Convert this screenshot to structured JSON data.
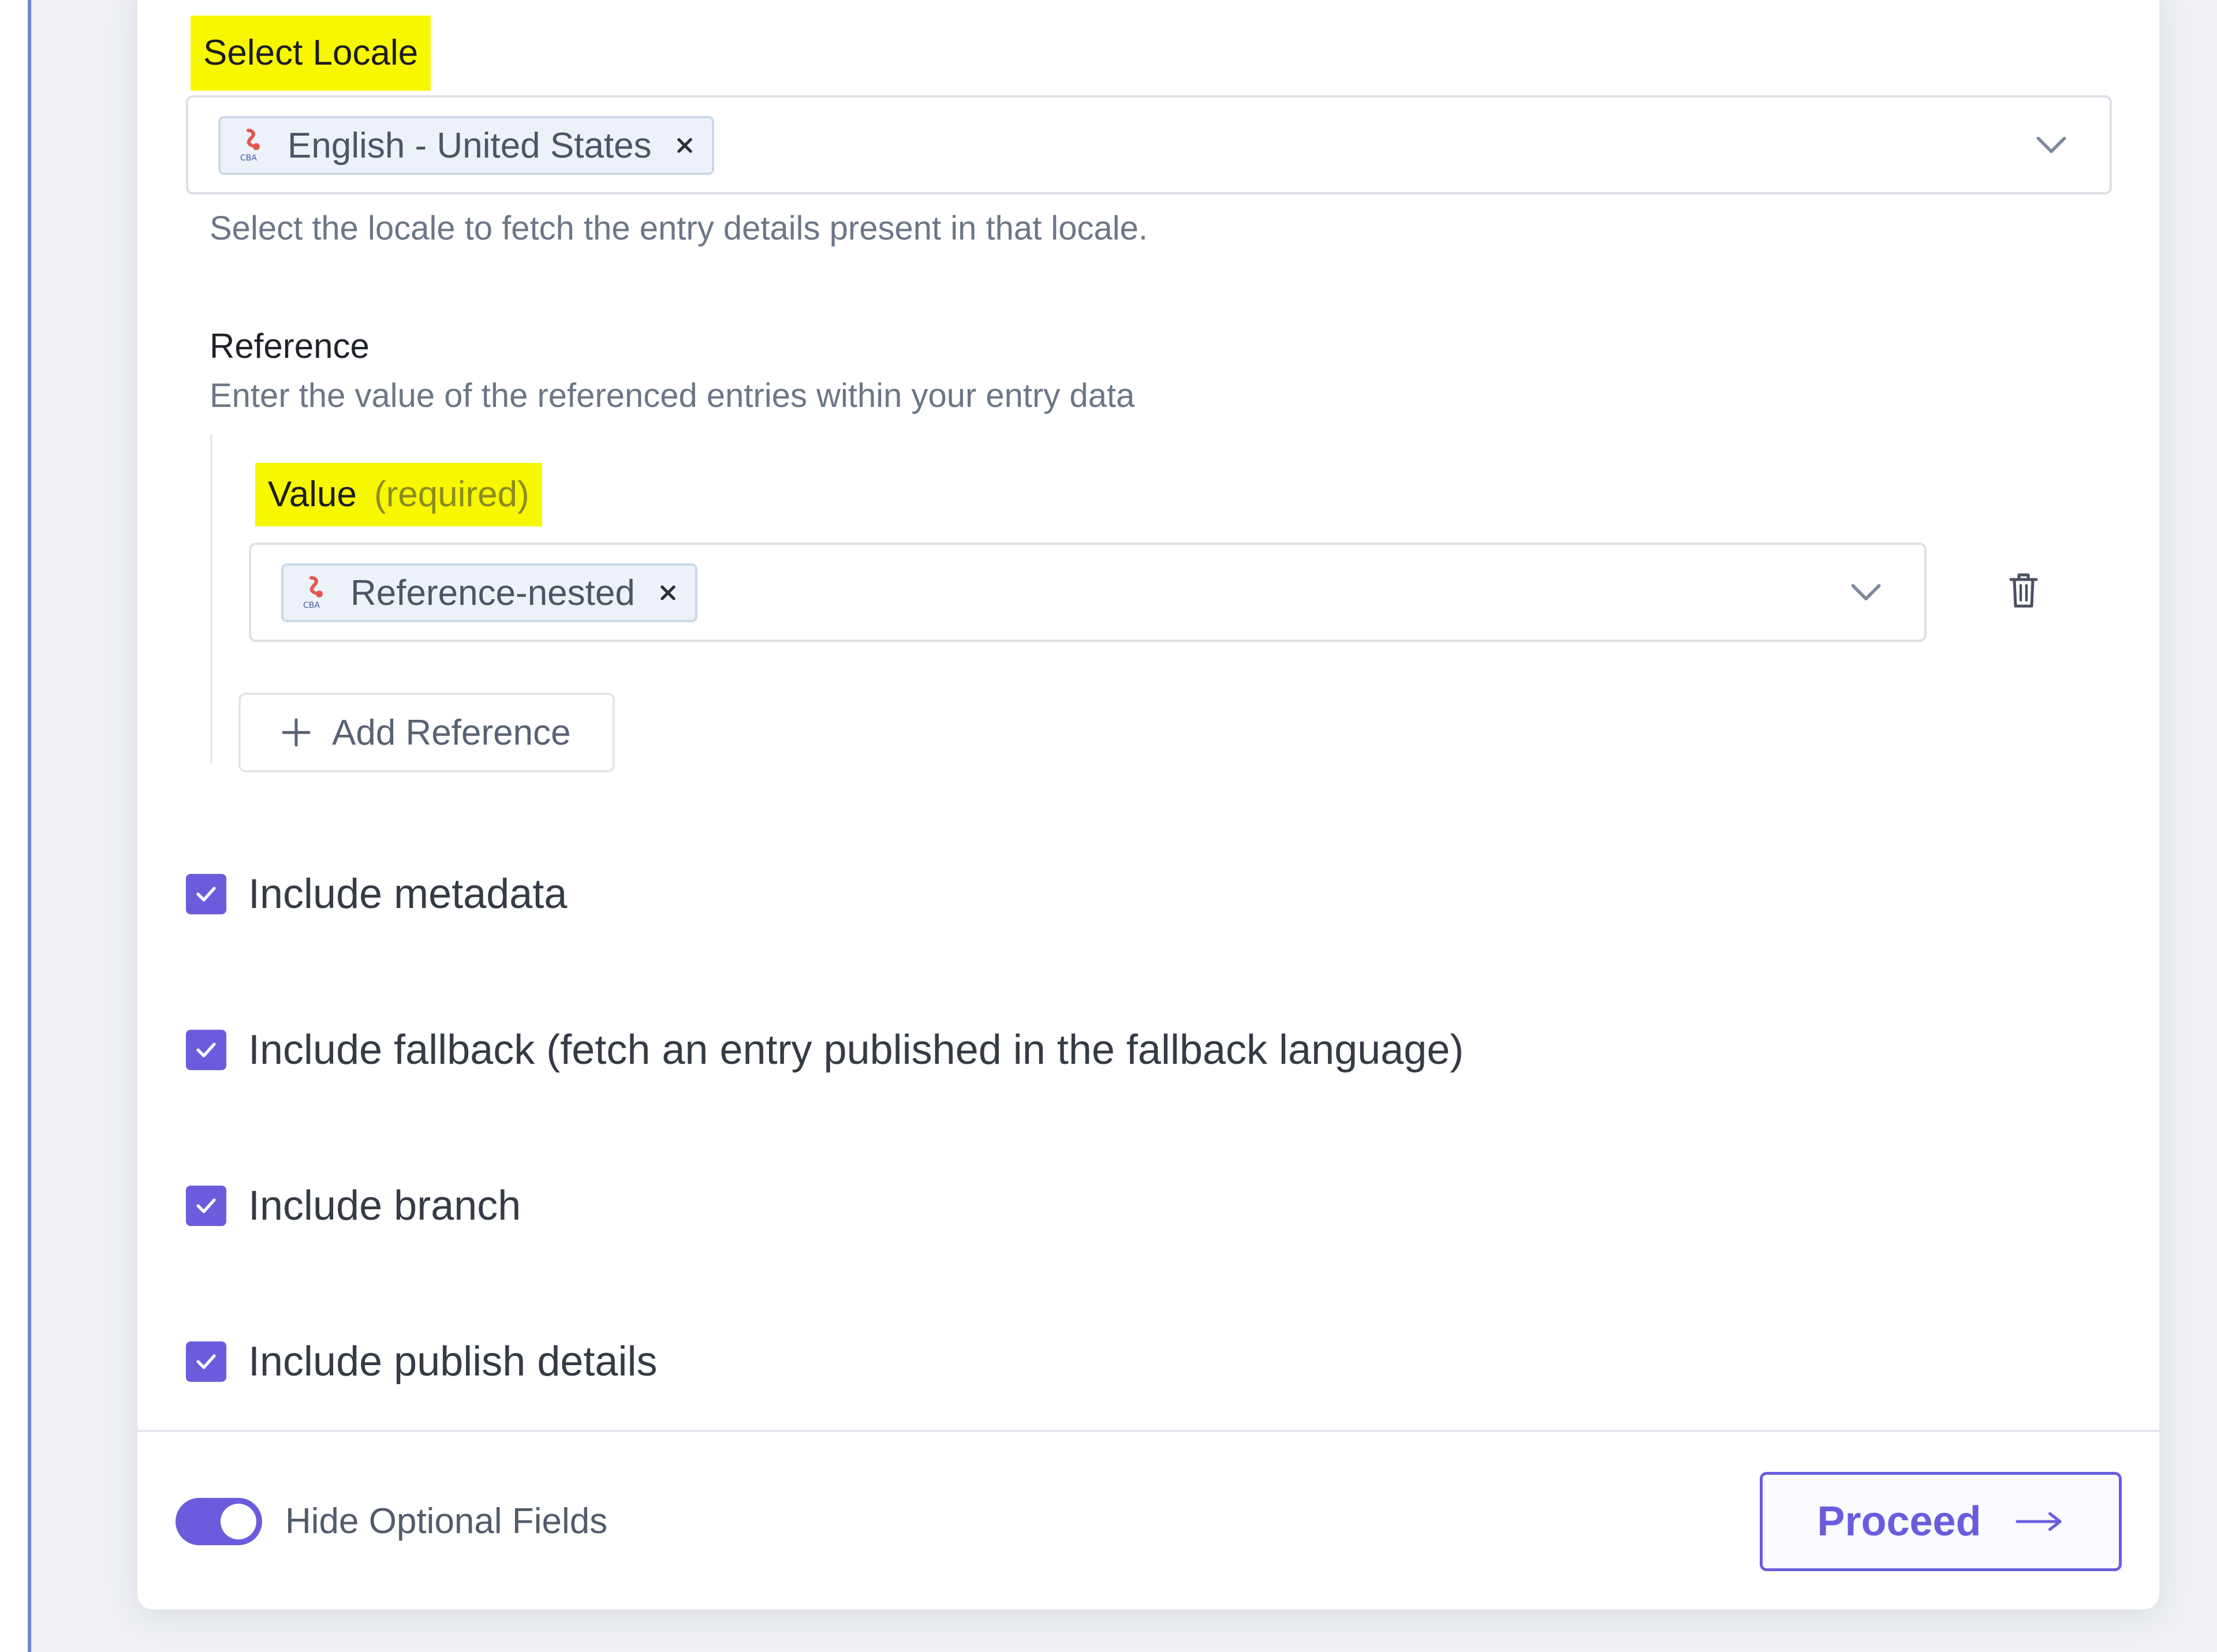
{
  "locale": {
    "label": "Select Locale",
    "selected_tag": "English - United States",
    "help": "Select the locale to fetch the entry details present in that locale."
  },
  "reference": {
    "title": "Reference",
    "help": "Enter the value of the referenced entries within your entry data",
    "value_label": "Value",
    "value_required": "(required)",
    "selected_tag": "Reference-nested",
    "add_label": "Add Reference"
  },
  "options": [
    {
      "label": "Include metadata",
      "checked": true
    },
    {
      "label": "Include fallback (fetch an entry published in the fallback language)",
      "checked": true
    },
    {
      "label": "Include branch",
      "checked": true
    },
    {
      "label": "Include publish details",
      "checked": true
    }
  ],
  "footer": {
    "toggle_label": "Hide Optional Fields",
    "toggle_on": true,
    "proceed_label": "Proceed"
  },
  "colors": {
    "accent": "#6b5cde",
    "highlight": "#f7f700"
  }
}
